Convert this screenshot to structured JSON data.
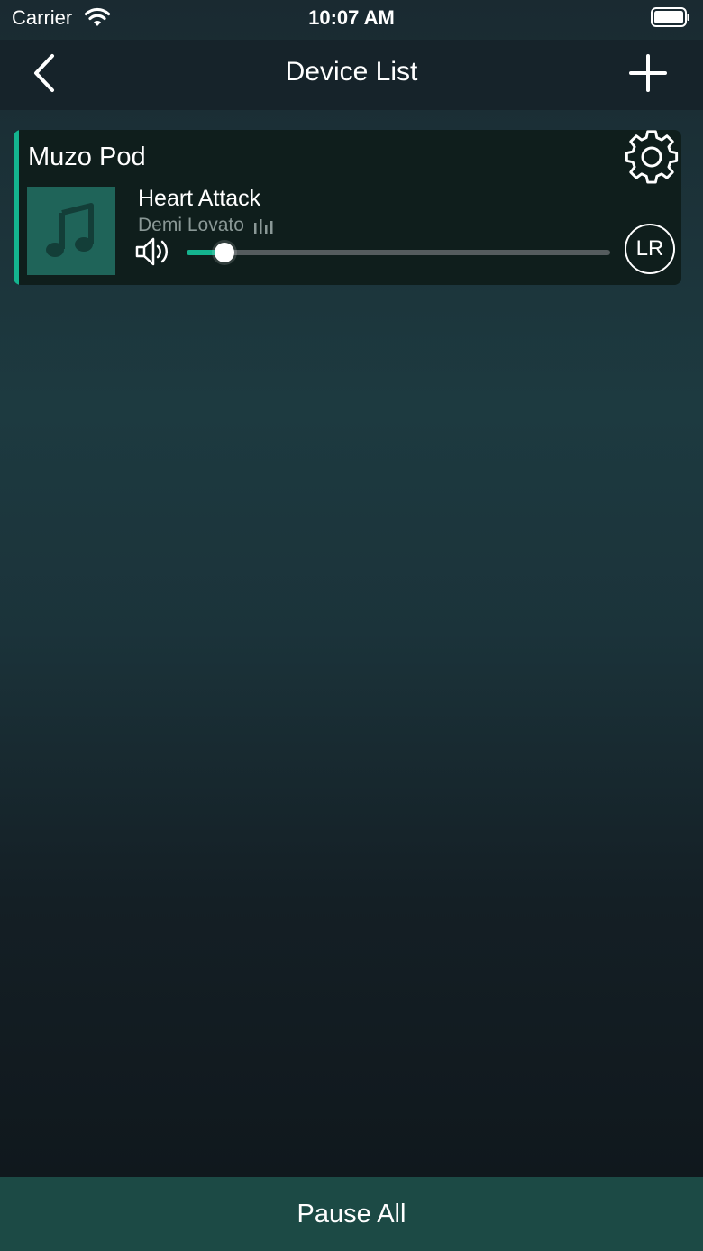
{
  "status_bar": {
    "carrier": "Carrier",
    "time": "10:07 AM"
  },
  "nav": {
    "title": "Device List",
    "back_icon": "chevron-left-icon",
    "add_icon": "plus-icon"
  },
  "devices": [
    {
      "name": "Muzo Pod",
      "song_title": "Heart Attack",
      "artist": "Demi Lovato",
      "volume_fraction": 0.09,
      "channel_label": "LR",
      "accent_color": "#14b48f"
    }
  ],
  "footer": {
    "pause_all_label": "Pause All"
  }
}
